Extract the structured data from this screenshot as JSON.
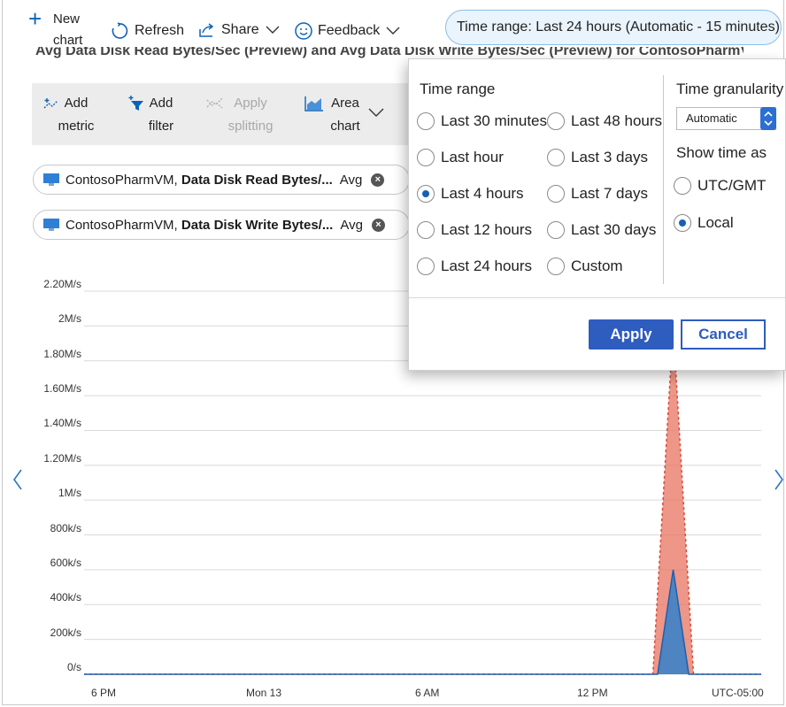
{
  "toolbar": {
    "new_chart": "New chart",
    "refresh": "Refresh",
    "share": "Share",
    "feedback": "Feedback",
    "time_range": "Time range: Last 24 hours (Automatic - 15 minutes)"
  },
  "chart_title": "Avg Data Disk Read Bytes/Sec (Preview) and Avg Data Disk Write Bytes/Sec (Preview) for ContosoPharmVM",
  "metric_toolbar": {
    "add_metric": "Add metric",
    "add_filter": "Add filter",
    "apply_splitting": "Apply splitting",
    "area_chart": "Area chart"
  },
  "metrics": [
    {
      "resource": "ContosoPharmVM,",
      "metric": "Data Disk Read Bytes/...",
      "agg": "Avg"
    },
    {
      "resource": "ContosoPharmVM,",
      "metric": "Data Disk Write Bytes/...",
      "agg": "Avg"
    }
  ],
  "time_popup": {
    "time_range_title": "Time range",
    "options": [
      {
        "label": "Last 30 minutes",
        "selected": false
      },
      {
        "label": "Last 48 hours",
        "selected": false
      },
      {
        "label": "Last hour",
        "selected": false
      },
      {
        "label": "Last 3 days",
        "selected": false
      },
      {
        "label": "Last 4 hours",
        "selected": true
      },
      {
        "label": "Last 7 days",
        "selected": false
      },
      {
        "label": "Last 12 hours",
        "selected": false
      },
      {
        "label": "Last 30 days",
        "selected": false
      },
      {
        "label": "Last 24 hours",
        "selected": false
      },
      {
        "label": "Custom",
        "selected": false
      }
    ],
    "granularity_title": "Time granularity",
    "granularity_value": "Automatic",
    "show_time_title": "Show time as",
    "time_options": [
      {
        "label": "UTC/GMT",
        "selected": false
      },
      {
        "label": "Local",
        "selected": true
      }
    ],
    "apply": "Apply",
    "cancel": "Cancel"
  },
  "chart_data": {
    "type": "area",
    "y_ticks": [
      "0/s",
      "200k/s",
      "400k/s",
      "600k/s",
      "800k/s",
      "1M/s",
      "1.20M/s",
      "1.40M/s",
      "1.60M/s",
      "1.80M/s",
      "2M/s",
      "2.20M/s"
    ],
    "x_ticks": [
      "6 PM",
      "Mon 13",
      "6 AM",
      "12 PM"
    ],
    "timezone": "UTC-05:00",
    "ylim": [
      0,
      2200000
    ],
    "grid": true,
    "series": [
      {
        "color": "#e8735f",
        "points": [
          [
            0,
            0
          ],
          [
            0.8,
            0
          ],
          [
            0.84,
            0
          ],
          [
            0.87,
            2000000
          ],
          [
            0.9,
            0
          ],
          [
            1,
            0
          ]
        ]
      },
      {
        "color": "#3b82c8",
        "points": [
          [
            0,
            0
          ],
          [
            0.8,
            0
          ],
          [
            0.847,
            0
          ],
          [
            0.87,
            600000
          ],
          [
            0.893,
            0
          ],
          [
            1,
            0
          ]
        ]
      }
    ]
  },
  "colors": {
    "accent": "#2e5cbf",
    "read_series": "#e8735f",
    "write_series": "#3b82c8"
  }
}
